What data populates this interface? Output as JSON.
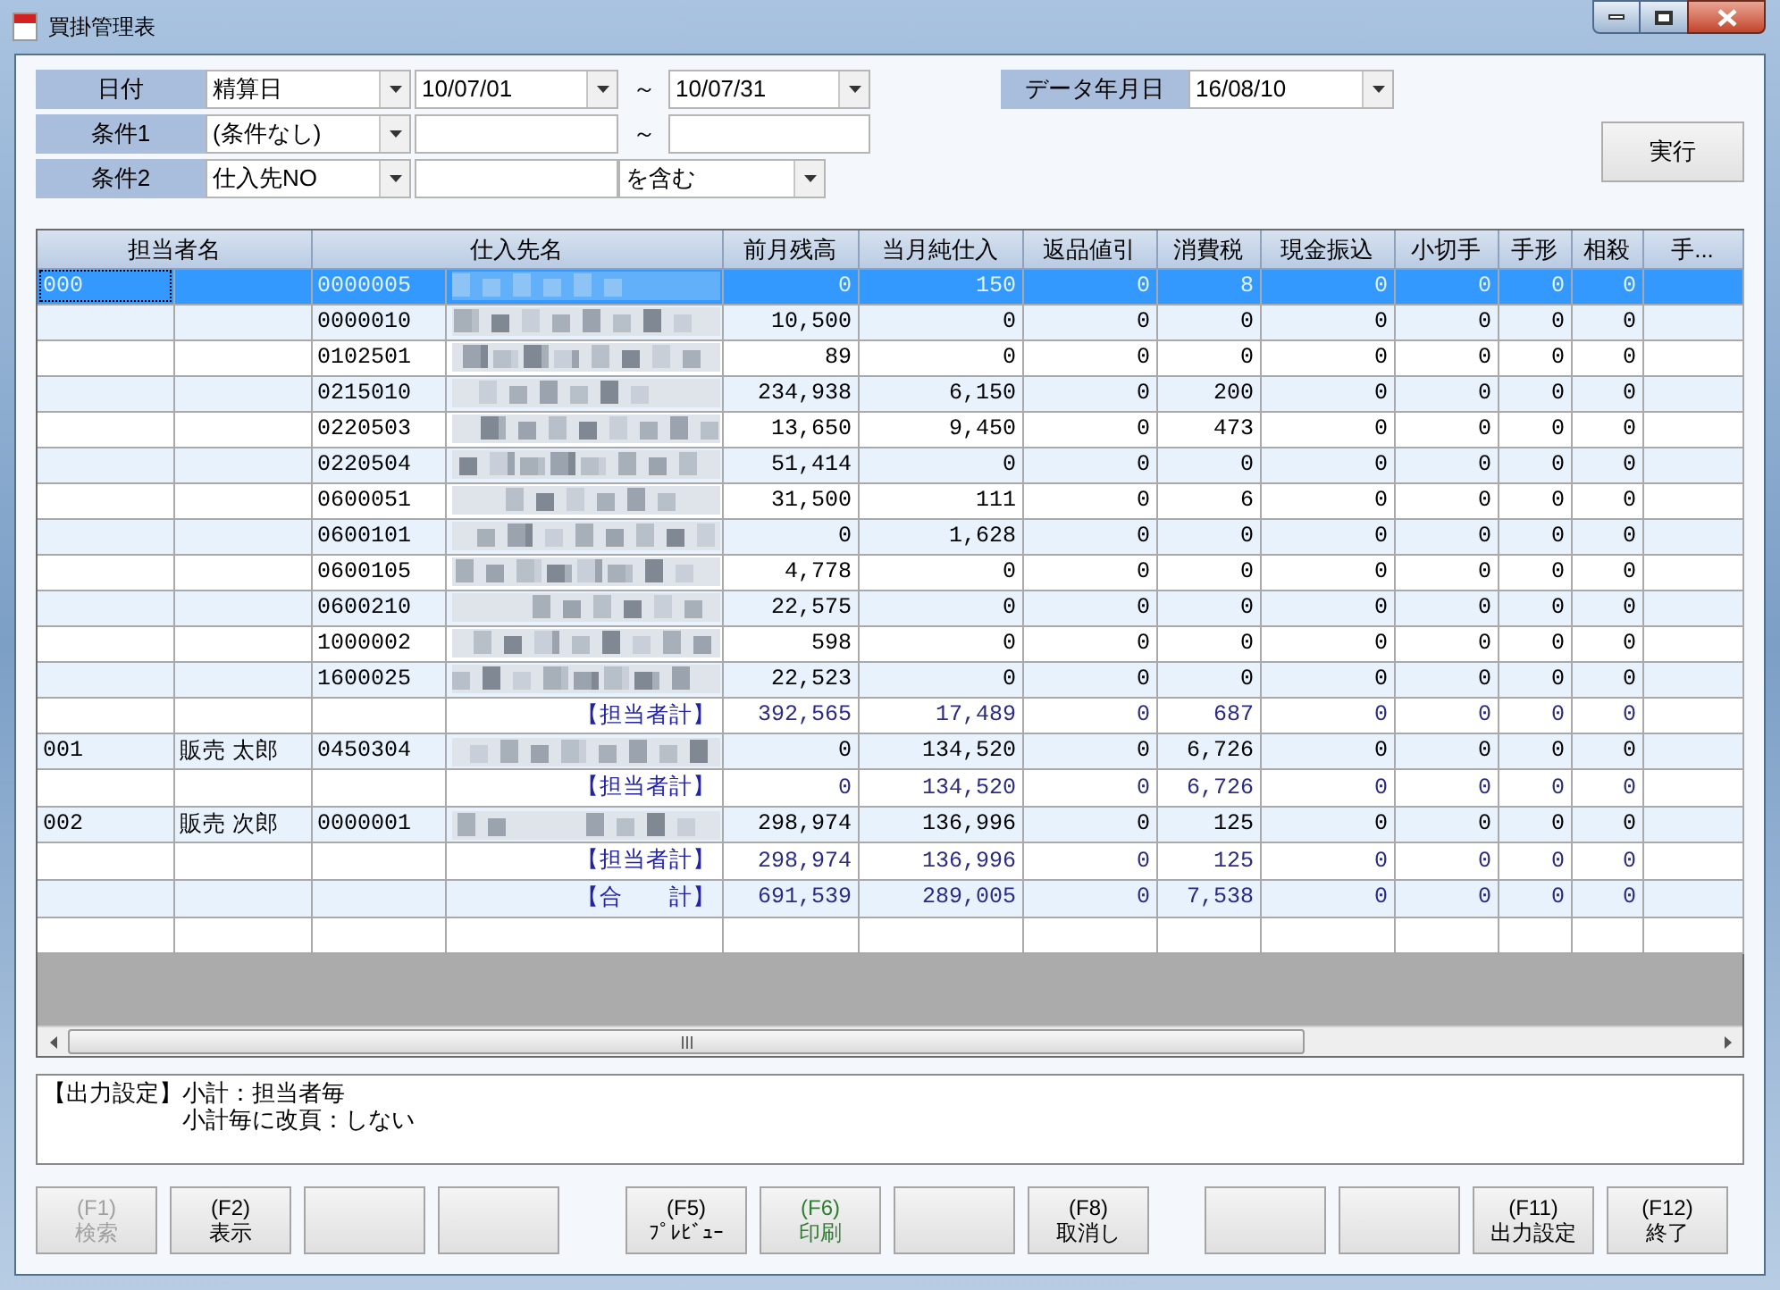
{
  "window": {
    "title": "買掛管理表"
  },
  "filters": {
    "date": {
      "label": "日付",
      "basis": "精算日",
      "from": "10/07/01",
      "separator": "～",
      "to": "10/07/31"
    },
    "condition1": {
      "label": "条件1",
      "field": "(条件なし)",
      "separator": "～"
    },
    "condition2": {
      "label": "条件2",
      "field": "仕入先NO",
      "match": "を含む"
    },
    "data_date": {
      "label": "データ年月日",
      "value": "16/08/10"
    },
    "run_button": "実行"
  },
  "table": {
    "group_headers": [
      "担当者名",
      "仕入先名"
    ],
    "columns": [
      "前月残高",
      "当月純仕入",
      "返品値引",
      "消費税",
      "現金振込",
      "小切手",
      "手形",
      "相殺",
      "手..."
    ],
    "rows": [
      {
        "kind": "detail",
        "selected": true,
        "staff_code": "000",
        "supplier_code": "0000005",
        "values": [
          "0",
          "150",
          "0",
          "8",
          "0",
          "0",
          "0",
          "0"
        ]
      },
      {
        "kind": "detail",
        "selected": false,
        "supplier_code": "0000010",
        "values": [
          "10,500",
          "0",
          "0",
          "0",
          "0",
          "0",
          "0",
          "0"
        ]
      },
      {
        "kind": "detail",
        "selected": false,
        "supplier_code": "0102501",
        "values": [
          "89",
          "0",
          "0",
          "0",
          "0",
          "0",
          "0",
          "0"
        ]
      },
      {
        "kind": "detail",
        "selected": false,
        "supplier_code": "0215010",
        "values": [
          "234,938",
          "6,150",
          "0",
          "200",
          "0",
          "0",
          "0",
          "0"
        ]
      },
      {
        "kind": "detail",
        "selected": false,
        "supplier_code": "0220503",
        "values": [
          "13,650",
          "9,450",
          "0",
          "473",
          "0",
          "0",
          "0",
          "0"
        ]
      },
      {
        "kind": "detail",
        "selected": false,
        "supplier_code": "0220504",
        "values": [
          "51,414",
          "0",
          "0",
          "0",
          "0",
          "0",
          "0",
          "0"
        ]
      },
      {
        "kind": "detail",
        "selected": false,
        "supplier_code": "0600051",
        "values": [
          "31,500",
          "111",
          "0",
          "6",
          "0",
          "0",
          "0",
          "0"
        ]
      },
      {
        "kind": "detail",
        "selected": false,
        "supplier_code": "0600101",
        "values": [
          "0",
          "1,628",
          "0",
          "0",
          "0",
          "0",
          "0",
          "0"
        ]
      },
      {
        "kind": "detail",
        "selected": false,
        "supplier_code": "0600105",
        "values": [
          "4,778",
          "0",
          "0",
          "0",
          "0",
          "0",
          "0",
          "0"
        ]
      },
      {
        "kind": "detail",
        "selected": false,
        "supplier_code": "0600210",
        "values": [
          "22,575",
          "0",
          "0",
          "0",
          "0",
          "0",
          "0",
          "0"
        ]
      },
      {
        "kind": "detail",
        "selected": false,
        "supplier_code": "1000002",
        "values": [
          "598",
          "0",
          "0",
          "0",
          "0",
          "0",
          "0",
          "0"
        ]
      },
      {
        "kind": "detail",
        "selected": false,
        "supplier_code": "1600025",
        "values": [
          "22,523",
          "0",
          "0",
          "0",
          "0",
          "0",
          "0",
          "0"
        ]
      },
      {
        "kind": "subtotal",
        "selected": false,
        "label": "【担当者計】",
        "values": [
          "392,565",
          "17,489",
          "0",
          "687",
          "0",
          "0",
          "0",
          "0"
        ]
      },
      {
        "kind": "detail",
        "selected": false,
        "staff_code": "001",
        "staff_name": "販売 太郎",
        "supplier_code": "0450304",
        "values": [
          "0",
          "134,520",
          "0",
          "6,726",
          "0",
          "0",
          "0",
          "0"
        ]
      },
      {
        "kind": "subtotal",
        "selected": false,
        "label": "【担当者計】",
        "values": [
          "0",
          "134,520",
          "0",
          "6,726",
          "0",
          "0",
          "0",
          "0"
        ]
      },
      {
        "kind": "detail",
        "selected": false,
        "staff_code": "002",
        "staff_name": "販売 次郎",
        "supplier_code": "0000001",
        "values": [
          "298,974",
          "136,996",
          "0",
          "125",
          "0",
          "0",
          "0",
          "0"
        ]
      },
      {
        "kind": "subtotal",
        "selected": false,
        "label": "【担当者計】",
        "values": [
          "298,974",
          "136,996",
          "0",
          "125",
          "0",
          "0",
          "0",
          "0"
        ]
      },
      {
        "kind": "subtotal",
        "selected": false,
        "label": "【合　　計】",
        "values": [
          "691,539",
          "289,005",
          "0",
          "7,538",
          "0",
          "0",
          "0",
          "0"
        ]
      },
      {
        "kind": "blank",
        "selected": false
      }
    ]
  },
  "output_settings": {
    "label": "【出力設定】",
    "lines": [
      "小計：担当者毎",
      "小計毎に改頁：しない"
    ]
  },
  "button_groups": [
    [
      {
        "kind": "function",
        "key": "(F1)",
        "label": "検索",
        "disabled": true
      },
      {
        "kind": "function",
        "key": "(F2)",
        "label": "表示",
        "disabled": false
      },
      {
        "kind": "empty"
      },
      {
        "kind": "empty"
      }
    ],
    [
      {
        "kind": "function",
        "key": "(F5)",
        "label": "ﾌﾟﾚﾋﾞｭｰ",
        "disabled": false
      },
      {
        "kind": "function",
        "key": "(F6)",
        "label": "印刷",
        "disabled": false,
        "color": "#2e7d32"
      },
      {
        "kind": "empty"
      },
      {
        "kind": "function",
        "key": "(F8)",
        "label": "取消し",
        "disabled": false
      }
    ],
    [
      {
        "kind": "empty"
      },
      {
        "kind": "empty"
      },
      {
        "kind": "function",
        "key": "(F11)",
        "label": "出力設定",
        "disabled": false
      },
      {
        "kind": "function",
        "key": "(F12)",
        "label": "終了",
        "disabled": false
      }
    ]
  ]
}
